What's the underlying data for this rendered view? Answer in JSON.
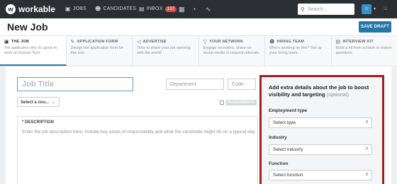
{
  "app": {
    "logo_text": "workable"
  },
  "nav": {
    "jobs": "JOBS",
    "candidates": "CANDIDATES",
    "inbox": "INBOX",
    "inbox_count": "137",
    "search_placeholder": "Search..."
  },
  "header": {
    "title": "New Job",
    "save_label": "SAVE DRAFT"
  },
  "steps": [
    {
      "title": "THE JOB",
      "desc": "Tell applicants why it's great to work at Groove Tech.",
      "icon": "briefcase-icon"
    },
    {
      "title": "APPLICATION FORM",
      "desc": "Design the application form for this role.",
      "icon": "form-icon"
    },
    {
      "title": "ADVERTISE",
      "desc": "Time to share your job opening with the world!",
      "icon": "megaphone-icon"
    },
    {
      "title": "YOUR NETWORK",
      "desc": "Engage recruiters, share on social media or request referrals.",
      "icon": "funnel-icon"
    },
    {
      "title": "HIRING TEAM",
      "desc": "Who's working on this? Set up your hiring team.",
      "icon": "people-icon"
    },
    {
      "title": "INTERVIEW KIT",
      "desc": "Build a kit from scratch or import questions",
      "icon": "kit-icon"
    }
  ],
  "form": {
    "job_title_placeholder": "Job Title",
    "department_placeholder": "Department",
    "code_placeholder": "Code",
    "country_label": "Select a cou...",
    "telecommute_label": "TELECOMMUTE",
    "description_label": "* DESCRIPTION",
    "description_placeholder": "Enter the job description here; include key areas of responsibility and what the candidate might do on a typical day."
  },
  "details": {
    "title": "Add extra details about the job to boost visibility and targeting",
    "optional": "(optional)",
    "employment_label": "Employment type",
    "employment_value": "Select type",
    "industry_label": "Industry",
    "industry_value": "Select industry",
    "function_label": "Function",
    "function_value": "Select function"
  }
}
